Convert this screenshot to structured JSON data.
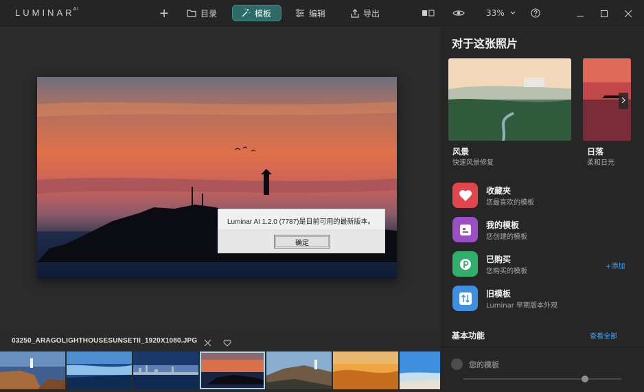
{
  "app": {
    "logo": "LUMINAR",
    "logo_sup": "AI"
  },
  "toolbar": {
    "add_label": "+",
    "library_label": "目录",
    "templates_label": "模板",
    "edit_label": "编辑",
    "export_label": "导出",
    "zoom_value": "33%"
  },
  "dialog": {
    "message": "Luminar AI 1.2.0 (7787)是目前可用的最新版本。",
    "ok_label": "确定"
  },
  "file": {
    "name": "03250_ARAGOLIGHTHOUSESUNSETII_1920X1080.JPG"
  },
  "filmstrip": {
    "thumbs": [
      "lighthouse-cliffs",
      "rocky-beach-blue",
      "city-skyline-dusk",
      "sunset-lighthouse-selected",
      "lighthouse-headland",
      "desert-dunes",
      "beach-blue-sky"
    ],
    "selected_index": 3
  },
  "panel": {
    "title": "对于这张照片",
    "cards": [
      {
        "name": "风景",
        "sub": "快速风景修复"
      },
      {
        "name": "日落",
        "sub": "柔和日光"
      }
    ],
    "collections": [
      {
        "name": "收藏夹",
        "sub": "您最喜欢的模板",
        "color": "#e0474c",
        "icon": "heart-icon"
      },
      {
        "name": "我的模板",
        "sub": "您创建的模板",
        "color": "#9b4fc4",
        "icon": "template-icon"
      },
      {
        "name": "已购买",
        "sub": "您购买的模板",
        "color": "#2fae6c",
        "icon": "purchase-icon"
      },
      {
        "name": "旧模板",
        "sub": "Luminar 早期版本外观",
        "color": "#3d8fe0",
        "icon": "legacy-icon"
      }
    ],
    "add_label": "+添加",
    "basic_title": "基本功能",
    "see_all": "查看全部",
    "your_templates": "您的模板"
  },
  "colors": {
    "accent": "#2e6b68",
    "link": "#3ea6ff"
  }
}
